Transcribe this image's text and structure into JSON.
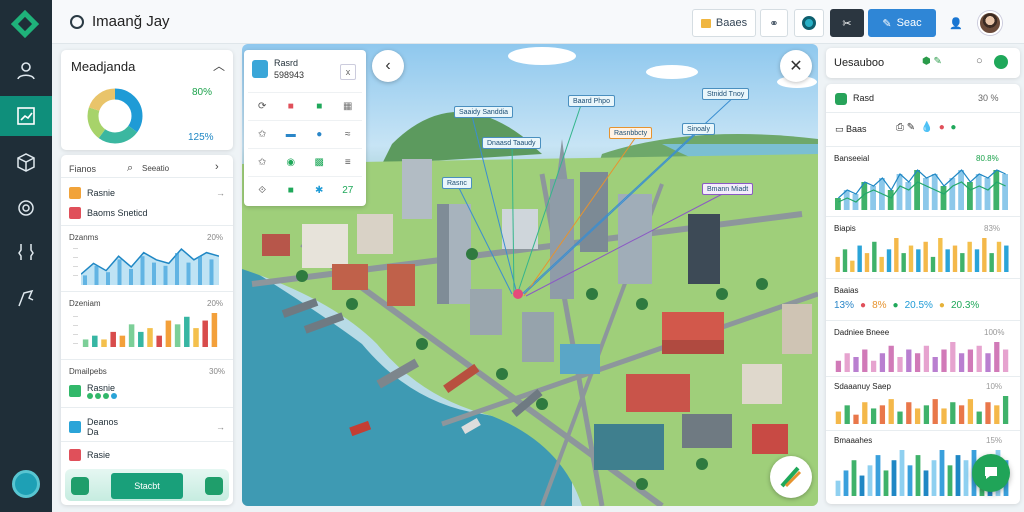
{
  "app": {
    "title": "Imaanğ Jay"
  },
  "toolbar": {
    "search_label": "Baaes",
    "action_label": "Seac",
    "icons": [
      "share-icon",
      "eye-icon",
      "scissors-icon",
      "search-icon",
      "user-icon"
    ]
  },
  "left_panel_overview": {
    "title": "Meadjanda",
    "stat_top": "80%",
    "stat_bottom": "125%",
    "donut": [
      {
        "label": "a",
        "value": 35,
        "color": "#1f9bd6"
      },
      {
        "label": "b",
        "value": 25,
        "color": "#3bb7a0"
      },
      {
        "label": "c",
        "value": 20,
        "color": "#a7d36a"
      },
      {
        "label": "d",
        "value": 20,
        "color": "#e9c46a"
      }
    ]
  },
  "left_panel_list": {
    "header": "Fianos",
    "search_placeholder": "Seeatio",
    "items": [
      {
        "label": "Rasnie",
        "color": "#f1a33a"
      },
      {
        "label": "Baoms Sneticd",
        "color": "#e0505a"
      }
    ],
    "chart1": {
      "title": "Dzanms",
      "value": "20%"
    },
    "chart2": {
      "title": "Dzeniam",
      "value": "20%"
    },
    "section2": {
      "title": "Dmailpebs",
      "value": "30%",
      "items": [
        {
          "label": "Rasnie",
          "sub": "",
          "color": "#32b86a"
        },
        {
          "label": "Deanos",
          "sub": "Da",
          "color": "#2aa4d8"
        },
        {
          "label": "Rasie",
          "sub": "",
          "color": "#e0505a"
        }
      ]
    },
    "footer_button": "Stacbt"
  },
  "tools_panel": {
    "title": "Rasrd",
    "subtitle": "598943",
    "close": "x",
    "cells": [
      "⟳",
      "■",
      "■",
      "▦",
      "✩",
      "▬",
      "●",
      "≈",
      "✩",
      "◉",
      "▩",
      "≡",
      "⟐",
      "■",
      "✱",
      "27"
    ]
  },
  "map": {
    "labels": [
      {
        "text": "Saaidy Sanddia",
        "style": "blue"
      },
      {
        "text": "Baard Phpo",
        "style": "blue"
      },
      {
        "text": "Stnidd Tnoy",
        "style": "blue"
      },
      {
        "text": "Dnaasd Taaudy",
        "style": "blue"
      },
      {
        "text": "Rasnbbcty",
        "style": "orange"
      },
      {
        "text": "Sinoaly",
        "style": "blue"
      },
      {
        "text": "Rasnc",
        "style": "blue"
      },
      {
        "text": "Bmann Miadt",
        "style": "purple"
      }
    ]
  },
  "right_panel": {
    "title": "Uesauboo",
    "tab_label": "Rasd",
    "tab_range": "30 %",
    "filter_label": "Baas",
    "sections": [
      {
        "title": "Banseeial",
        "value": "80.8%"
      },
      {
        "title": "Biapis",
        "value": "83%"
      },
      {
        "title": "Baaias",
        "stats": [
          "13%",
          "8%",
          "20.5%",
          "20.3%"
        ]
      },
      {
        "title": "Dadniee Bneee",
        "value": "100%"
      },
      {
        "title": "Sdaaanuy Saep",
        "value": "10%"
      },
      {
        "title": "Bmaaahes",
        "value": "15%"
      }
    ]
  },
  "chart_data": [
    {
      "type": "pie",
      "values": [
        35,
        25,
        20,
        20
      ],
      "colors": [
        "#1f9bd6",
        "#3bb7a0",
        "#a7d36a",
        "#e9c46a"
      ]
    },
    {
      "type": "area",
      "series": [
        {
          "values": [
            3,
            6,
            4,
            8,
            5,
            9,
            7,
            6,
            10,
            7,
            9,
            8
          ]
        }
      ]
    },
    {
      "type": "bar",
      "series": [
        {
          "values": [
            2,
            3,
            2,
            4,
            3,
            6,
            4,
            5,
            3,
            7,
            6,
            8,
            5,
            7,
            9
          ]
        }
      ]
    },
    {
      "type": "line",
      "series": [
        {
          "values": [
            3,
            5,
            4,
            7,
            6,
            8,
            5,
            9,
            7,
            10,
            8,
            9,
            6,
            8,
            10,
            7,
            9,
            8,
            10,
            9
          ]
        },
        {
          "values": [
            2,
            3,
            2,
            4,
            5,
            4,
            3,
            6,
            5,
            7,
            6,
            5,
            4,
            6,
            7,
            5,
            6,
            5,
            7,
            6
          ]
        }
      ]
    },
    {
      "type": "bar",
      "series": [
        {
          "values": [
            4,
            6,
            3,
            7,
            5,
            8,
            4,
            6,
            9,
            5,
            7,
            6,
            8,
            4,
            9,
            6,
            7,
            5,
            8,
            6,
            9,
            5,
            8,
            7
          ]
        }
      ]
    },
    {
      "type": "bar",
      "series": [
        {
          "values": [
            3,
            5,
            4,
            6,
            3,
            5,
            7,
            4,
            6,
            5,
            7,
            4,
            6,
            8,
            5,
            6,
            7,
            5,
            8,
            6
          ]
        }
      ]
    },
    {
      "type": "bar",
      "series": [
        {
          "values": [
            4,
            6,
            3,
            7,
            5,
            6,
            8,
            4,
            7,
            5,
            6,
            8,
            5,
            7,
            6,
            8,
            4,
            7,
            6,
            9
          ]
        }
      ]
    },
    {
      "type": "bar",
      "series": [
        {
          "values": [
            3,
            5,
            7,
            4,
            6,
            8,
            5,
            7,
            9,
            6,
            8,
            5,
            7,
            9,
            6,
            8,
            7,
            9,
            6,
            8,
            9,
            7
          ]
        }
      ]
    }
  ]
}
